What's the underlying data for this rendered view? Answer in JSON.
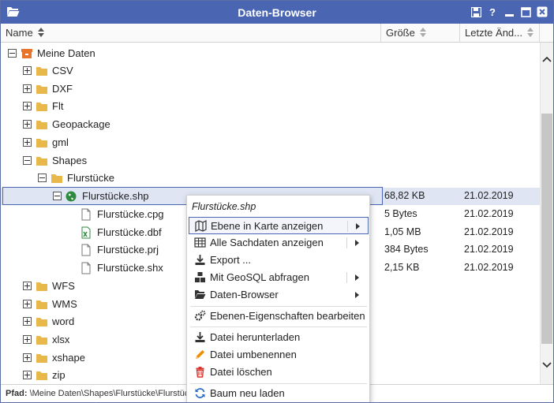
{
  "window": {
    "title": "Daten-Browser"
  },
  "columns": {
    "name": "Name",
    "size": "Größe",
    "date": "Letzte Änd..."
  },
  "tree": {
    "root": "Meine Daten",
    "items": [
      {
        "label": "CSV"
      },
      {
        "label": "DXF"
      },
      {
        "label": "Flt"
      },
      {
        "label": "Geopackage"
      },
      {
        "label": "gml"
      },
      {
        "label": "Shapes"
      },
      {
        "label": "Flurstücke"
      },
      {
        "label": "Flurstücke.shp",
        "size": "68,82 KB",
        "date": "21.02.2019"
      },
      {
        "label": "Flurstücke.cpg",
        "size": "5 Bytes",
        "date": "21.02.2019"
      },
      {
        "label": "Flurstücke.dbf",
        "size": "1,05 MB",
        "date": "21.02.2019"
      },
      {
        "label": "Flurstücke.prj",
        "size": "384 Bytes",
        "date": "21.02.2019"
      },
      {
        "label": "Flurstücke.shx",
        "size": "2,15 KB",
        "date": "21.02.2019"
      },
      {
        "label": "WFS"
      },
      {
        "label": "WMS"
      },
      {
        "label": "word"
      },
      {
        "label": "xlsx"
      },
      {
        "label": "xshape"
      },
      {
        "label": "zip"
      }
    ]
  },
  "footer": {
    "label": "Pfad:",
    "path": "\\Meine Daten\\Shapes\\Flurstücke\\Flurstücke.shp"
  },
  "context_menu": {
    "title": "Flurstücke.shp",
    "items": [
      {
        "label": "Ebene in Karte anzeigen",
        "icon": "map-icon"
      },
      {
        "label": "Alle Sachdaten anzeigen",
        "icon": "table-icon"
      },
      {
        "label": "Export ...",
        "icon": "download-icon"
      },
      {
        "label": "Mit GeoSQL abfragen",
        "icon": "cubes-icon"
      },
      {
        "label": "Daten-Browser",
        "icon": "folder-open-icon"
      },
      {
        "label": "Ebenen-Eigenschaften bearbeiten",
        "icon": "gears-icon"
      },
      {
        "label": "Datei herunterladen",
        "icon": "download-icon"
      },
      {
        "label": "Datei umbenennen",
        "icon": "pencil-icon"
      },
      {
        "label": "Datei löschen",
        "icon": "trash-icon"
      },
      {
        "label": "Baum neu laden",
        "icon": "refresh-icon"
      }
    ]
  },
  "colors": {
    "titlebar": "#4a66b3",
    "folder": "#e8b84a",
    "selected_row": "#dfe5f3",
    "delete": "#d9342b",
    "edit": "#f08c00",
    "refresh": "#2b6cc4"
  }
}
